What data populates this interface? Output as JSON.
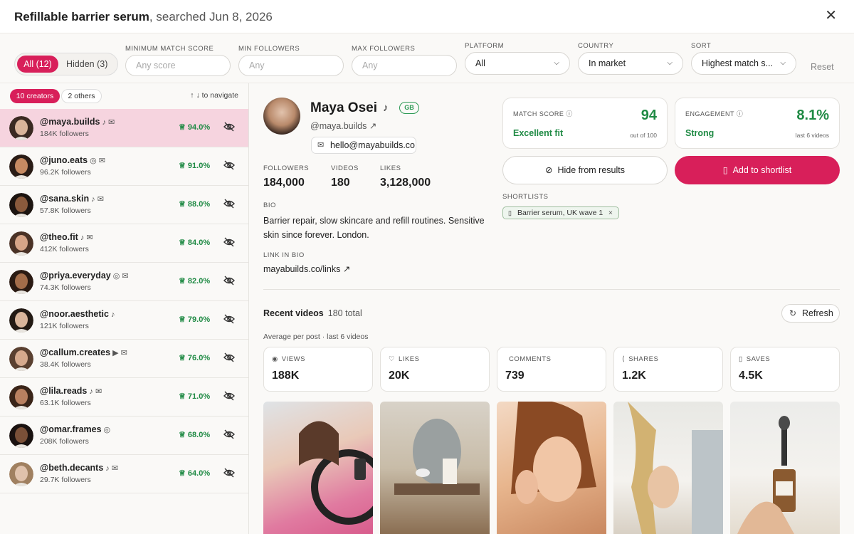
{
  "header": {
    "title_bold": "Refillable barrier serum",
    "title_rest": ", searched Jun 8, 2026",
    "close": "✕"
  },
  "filters": {
    "all_label": "All (12)",
    "hidden_label": "Hidden (3)",
    "min_score_label": "MINIMUM MATCH SCORE",
    "min_score_placeholder": "Any score",
    "min_followers_label": "MIN FOLLOWERS",
    "min_followers_placeholder": "Any",
    "max_followers_label": "MAX FOLLOWERS",
    "max_followers_placeholder": "Any",
    "platform_label": "PLATFORM",
    "platform_value": "All",
    "country_label": "COUNTRY",
    "country_value": "In market",
    "sort_label": "SORT",
    "sort_value": "Highest match s...",
    "reset": "Reset"
  },
  "list": {
    "tab_creators": "10 creators",
    "tab_others": "2 others",
    "nav_hint": "↑ ↓ to navigate",
    "creators": [
      {
        "handle": "@maya.builds",
        "icons": "♪ ✉",
        "followers": "184K followers",
        "score": "94.0%",
        "skin": "#d9b59b",
        "hair": "#3a2a22"
      },
      {
        "handle": "@juno.eats",
        "icons": "◎ ✉",
        "followers": "96.2K followers",
        "score": "91.0%",
        "skin": "#c68a62",
        "hair": "#2a1c16"
      },
      {
        "handle": "@sana.skin",
        "icons": "♪ ✉",
        "followers": "57.8K followers",
        "score": "88.0%",
        "skin": "#8a5a3c",
        "hair": "#1c1410"
      },
      {
        "handle": "@theo.fit",
        "icons": "♪ ✉",
        "followers": "412K followers",
        "score": "84.0%",
        "skin": "#d7a588",
        "hair": "#4a3226"
      },
      {
        "handle": "@priya.everyday",
        "icons": "◎ ✉",
        "followers": "74.3K followers",
        "score": "82.0%",
        "skin": "#a36d4a",
        "hair": "#2a1a12"
      },
      {
        "handle": "@noor.aesthetic",
        "icons": "♪",
        "followers": "121K followers",
        "score": "79.0%",
        "skin": "#d9b59b",
        "hair": "#231a14"
      },
      {
        "handle": "@callum.creates",
        "icons": "▶ ✉",
        "followers": "38.4K followers",
        "score": "76.0%",
        "skin": "#d6aa8e",
        "hair": "#5a4030"
      },
      {
        "handle": "@lila.reads",
        "icons": "♪ ✉",
        "followers": "63.1K followers",
        "score": "71.0%",
        "skin": "#b98060",
        "hair": "#3a2418"
      },
      {
        "handle": "@omar.frames",
        "icons": "◎",
        "followers": "208K followers",
        "score": "68.0%",
        "skin": "#7a5038",
        "hair": "#1a1210"
      },
      {
        "handle": "@beth.decants",
        "icons": "♪ ✉",
        "followers": "29.7K followers",
        "score": "64.0%",
        "skin": "#e0c2ac",
        "hair": "#a08060"
      }
    ]
  },
  "profile": {
    "name": "Maya Osei",
    "platform_icon": "♪",
    "country": "GB",
    "handle": "@maya.builds ↗",
    "email": "hello@mayabuilds.co",
    "followers_label": "FOLLOWERS",
    "followers": "184,000",
    "videos_label": "VIDEOS",
    "videos": "180",
    "likes_label": "LIKES",
    "likes": "3,128,000",
    "bio_label": "BIO",
    "bio": "Barrier repair, slow skincare and refill routines. Sensitive skin since forever. London.",
    "link_label": "LINK IN BIO",
    "link": "mayabuilds.co/links ↗"
  },
  "scores": {
    "match_label": "MATCH SCORE ⓘ",
    "match_value": "94",
    "match_status": "Excellent fit",
    "match_foot": "out of 100",
    "eng_label": "ENGAGEMENT ⓘ",
    "eng_value": "8.1%",
    "eng_status": "Strong",
    "eng_foot": "last 6 videos"
  },
  "actions": {
    "hide": "Hide from results",
    "add": "Add to shortlist",
    "shortlists_label": "SHORTLISTS",
    "shortlist_chip": "Barrier serum, UK wave 1",
    "chip_x": "×"
  },
  "videos": {
    "title": "Recent videos",
    "total": "180 total",
    "refresh": "Refresh",
    "avg": "Average per post · last 6 videos",
    "metrics": [
      {
        "icon": "◉",
        "label": "VIEWS",
        "value": "188K"
      },
      {
        "icon": "♡",
        "label": "LIKES",
        "value": "20K"
      },
      {
        "icon": "",
        "label": "COMMENTS",
        "value": "739"
      },
      {
        "icon": "⟨",
        "label": "SHARES",
        "value": "1.2K"
      },
      {
        "icon": "▯",
        "label": "SAVES",
        "value": "4.5K"
      }
    ]
  },
  "colors": {
    "accent": "#d81f5a",
    "good": "#1f8a44"
  }
}
